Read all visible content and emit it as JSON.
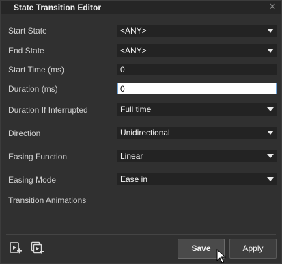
{
  "window": {
    "title": "State Transition Editor",
    "close_glyph": "✕"
  },
  "fields": {
    "start_state": {
      "label": "Start State",
      "value": "<ANY>"
    },
    "end_state": {
      "label": "End State",
      "value": "<ANY>"
    },
    "start_time": {
      "label": "Start Time (ms)",
      "value": "0"
    },
    "duration": {
      "label": "Duration (ms)",
      "value": "0"
    },
    "duration_if_interrupted": {
      "label": "Duration If Interrupted",
      "value": "Full time"
    },
    "direction": {
      "label": "Direction",
      "value": "Unidirectional"
    },
    "easing_function": {
      "label": "Easing Function",
      "value": "Linear"
    },
    "easing_mode": {
      "label": "Easing Mode",
      "value": "Ease in"
    }
  },
  "section": {
    "transition_animations": "Transition Animations"
  },
  "buttons": {
    "save": "Save",
    "apply": "Apply"
  },
  "icons": {
    "add_animation": "add-animation-icon",
    "duplicate_animation": "duplicate-animation-icon",
    "close": "close-icon"
  },
  "colors": {
    "background": "#303030",
    "titlebar": "#262626",
    "input_bg": "#232323",
    "focused_input_bg": "#ffffff",
    "focus_border": "#6ea2d6"
  }
}
